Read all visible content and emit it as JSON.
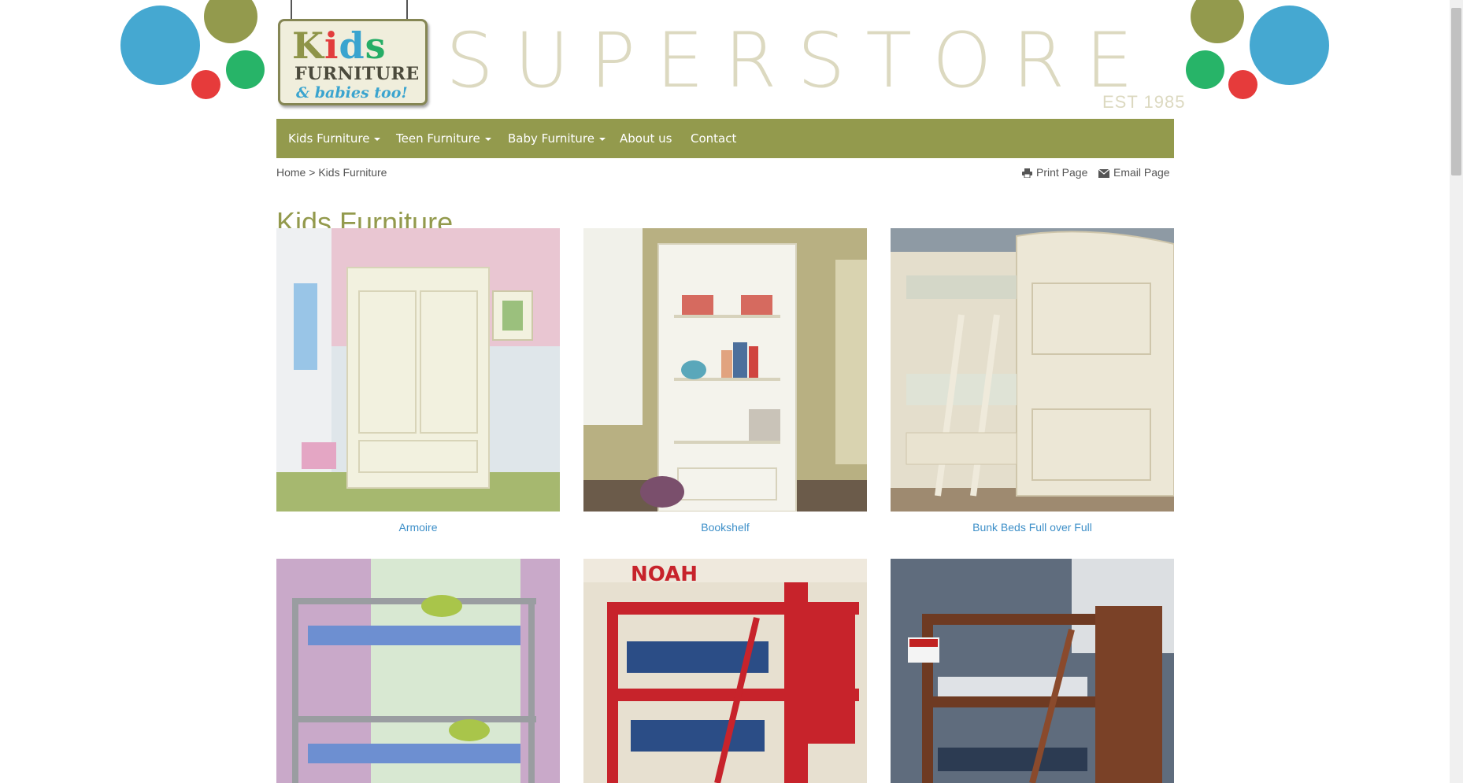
{
  "brand": {
    "logo_word": "Kids",
    "logo_line2": "FURNITURE",
    "logo_line3": "& babies too!",
    "store_name": "SUPERSTORE",
    "est": "EST 1985"
  },
  "nav": {
    "items": [
      {
        "label": "Kids Furniture",
        "dropdown": true
      },
      {
        "label": "Teen Furniture",
        "dropdown": true
      },
      {
        "label": "Baby Furniture",
        "dropdown": true
      },
      {
        "label": "About us",
        "dropdown": false
      },
      {
        "label": "Contact",
        "dropdown": false
      }
    ]
  },
  "breadcrumb": {
    "home": "Home",
    "separator": ">",
    "current": "Kids Furniture"
  },
  "utilities": {
    "print": "Print Page",
    "email": "Email Page"
  },
  "page": {
    "title": "Kids Furniture"
  },
  "products": [
    {
      "name": "Armoire"
    },
    {
      "name": "Bookshelf"
    },
    {
      "name": "Bunk Beds Full over Full"
    },
    {
      "name": ""
    },
    {
      "name": ""
    },
    {
      "name": ""
    }
  ],
  "colors": {
    "accent": "#939a4d",
    "link": "#3d8fc8",
    "dot_blue": "#45a8d1",
    "dot_olive": "#939a4d",
    "dot_green": "#27b468",
    "dot_red": "#e63b3b"
  }
}
